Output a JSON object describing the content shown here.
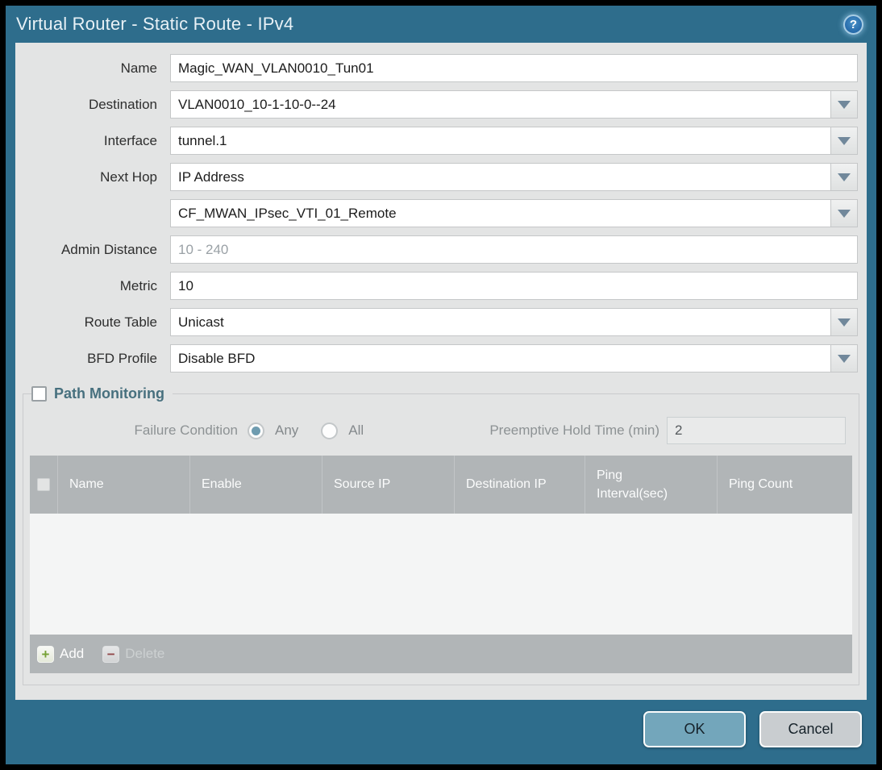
{
  "window": {
    "title": "Virtual Router - Static Route - IPv4",
    "help_icon": "?"
  },
  "colors": {
    "titlebar": "#2e6d8c",
    "content_bg": "#e3e4e4",
    "table_header_bg": "#b1b5b7",
    "ok_button_bg": "#73a6bb",
    "cancel_button_bg": "#c9cdd0",
    "add_icon_green": "#76a136",
    "delete_icon_red": "#92494b",
    "radio_selected": "#6f9cb0",
    "section_title": "#47707e"
  },
  "form": {
    "fields": [
      {
        "label": "Name",
        "value": "Magic_WAN_VLAN0010_Tun01"
      },
      {
        "label": "Destination",
        "value": "VLAN0010_10-1-10-0--24"
      },
      {
        "label": "Interface",
        "value": "tunnel.1"
      },
      {
        "label": "Next Hop",
        "value": "IP Address"
      },
      {
        "label": "",
        "value": "CF_MWAN_IPsec_VTI_01_Remote"
      },
      {
        "label": "Admin Distance",
        "value": "",
        "placeholder": "10 - 240"
      },
      {
        "label": "Metric",
        "value": "10"
      },
      {
        "label": "Route Table",
        "value": "Unicast"
      },
      {
        "label": "BFD Profile",
        "value": "Disable BFD"
      }
    ]
  },
  "path_monitoring": {
    "title": "Path Monitoring",
    "enabled": false,
    "failure_condition": {
      "label": "Failure Condition",
      "options": [
        {
          "label": "Any",
          "selected": true
        },
        {
          "label": "All",
          "selected": false
        }
      ]
    },
    "preemptive": {
      "label": "Preemptive Hold Time (min)",
      "value": "2"
    },
    "table": {
      "select_all_checked": false,
      "columns": [
        "Name",
        "Enable",
        "Source IP",
        "Destination IP",
        "Ping Interval(sec)",
        "Ping Count"
      ],
      "rows": [],
      "toolbar": {
        "add_label": "Add",
        "delete_label": "Delete",
        "delete_enabled": false
      }
    }
  },
  "footer": {
    "ok_label": "OK",
    "cancel_label": "Cancel"
  }
}
